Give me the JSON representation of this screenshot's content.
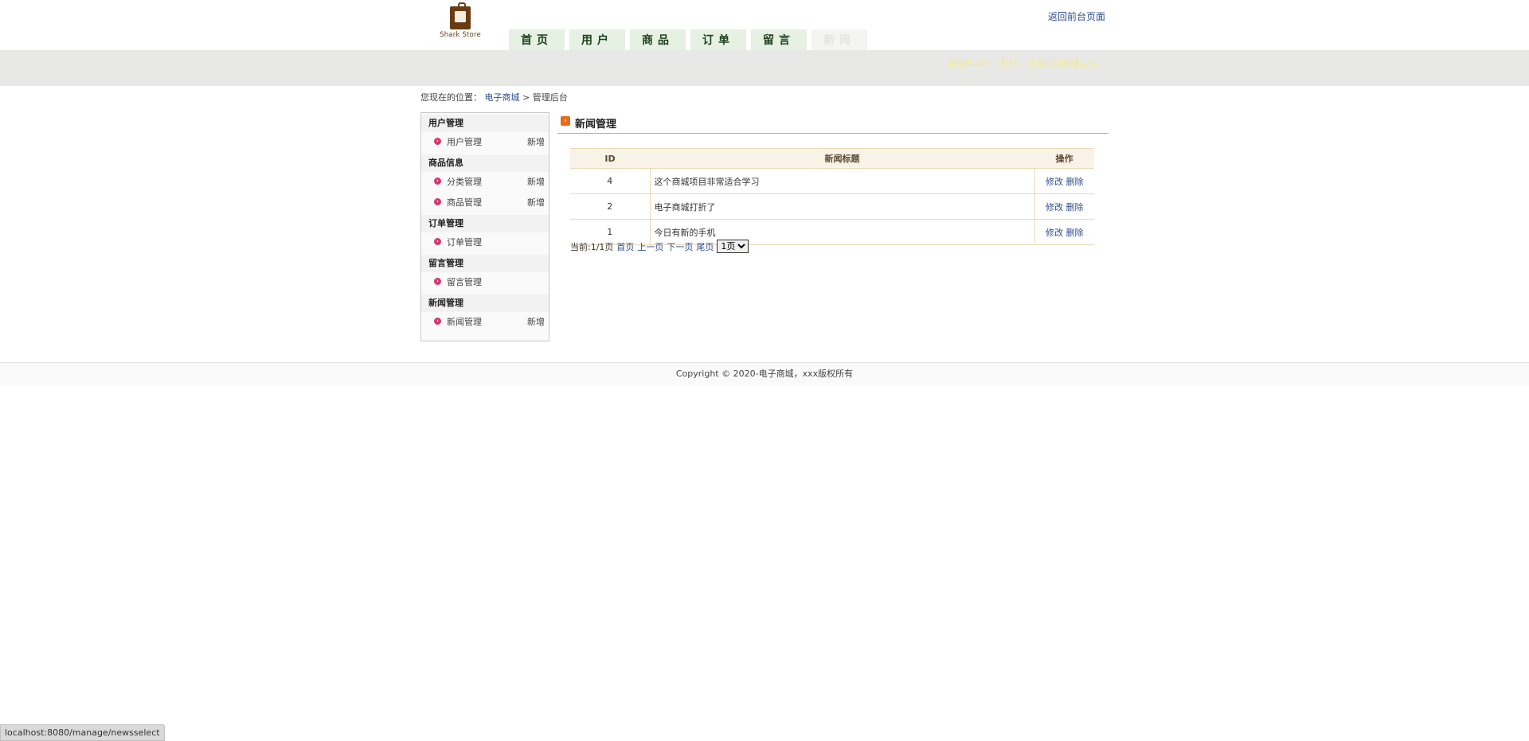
{
  "header": {
    "logo_text": "Shark Store",
    "return_link": "返回前台页面",
    "nav": [
      {
        "label": "首页",
        "active": false
      },
      {
        "label": "用户",
        "active": false
      },
      {
        "label": "商品",
        "active": false
      },
      {
        "label": "订单",
        "active": false
      },
      {
        "label": "留言",
        "active": false
      },
      {
        "label": "新闻",
        "active": true
      }
    ],
    "welcome": "管理员admin您好，欢迎回到管理后台。"
  },
  "breadcrumb": {
    "prefix": "您现在的位置：",
    "link": "电子商城",
    "separator": ">",
    "current": "管理后台"
  },
  "sidebar": {
    "sections": [
      {
        "title": "用户管理",
        "items": [
          {
            "label": "用户管理",
            "add": "新增"
          }
        ]
      },
      {
        "title": "商品信息",
        "items": [
          {
            "label": "分类管理",
            "add": "新增"
          },
          {
            "label": "商品管理",
            "add": "新增"
          }
        ]
      },
      {
        "title": "订单管理",
        "items": [
          {
            "label": "订单管理",
            "add": ""
          }
        ]
      },
      {
        "title": "留言管理",
        "items": [
          {
            "label": "留言管理",
            "add": ""
          }
        ]
      },
      {
        "title": "新闻管理",
        "items": [
          {
            "label": "新闻管理",
            "add": "新增"
          }
        ]
      }
    ]
  },
  "main": {
    "title": "新闻管理",
    "table": {
      "columns": [
        "ID",
        "新闻标题",
        "操作"
      ],
      "rows": [
        {
          "id": "4",
          "title": "这个商城项目非常适合学习",
          "edit": "修改",
          "delete": "删除"
        },
        {
          "id": "2",
          "title": "电子商城打折了",
          "edit": "修改",
          "delete": "删除"
        },
        {
          "id": "1",
          "title": "今日有新的手机",
          "edit": "修改",
          "delete": "删除"
        }
      ]
    },
    "pager": {
      "current": "当前:1/1页",
      "first": "首页",
      "prev": "上一页",
      "next": "下一页",
      "last": "尾页",
      "select_value": "1页"
    }
  },
  "footer": {
    "copyright": "Copyright © 2020-电子商城，xxx版权所有"
  },
  "status_bar": {
    "url": "localhost:8080/manage/newsselect"
  }
}
